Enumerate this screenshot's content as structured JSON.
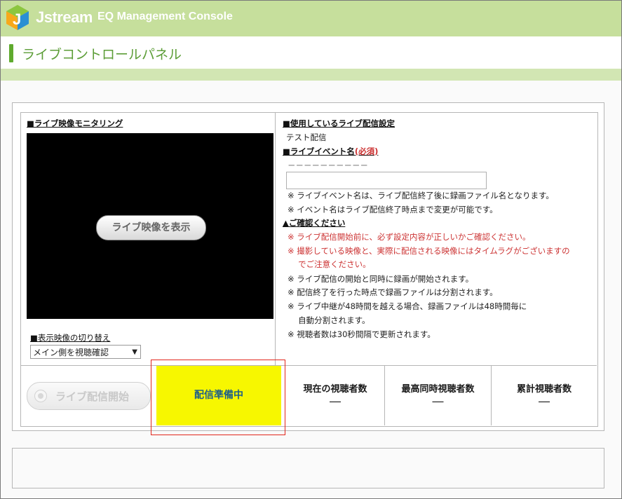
{
  "header": {
    "logo_text": "Jstream",
    "app_title": "EQ Management Console"
  },
  "page": {
    "title": "ライブコントロールパネル"
  },
  "left_panel": {
    "monitor_heading": "■ライブ映像モニタリング",
    "show_video_button": "ライブ映像を表示",
    "switch_heading": "■表示映像の切り替え",
    "switch_select_value": "メイン側を視聴確認"
  },
  "right_panel": {
    "settings_heading": "■使用しているライブ配信設定",
    "settings_value": "テスト配信",
    "event_name_heading": "■ライブイベント名",
    "event_name_required": "(必須)",
    "event_name_value": "－－－－－－－－－－",
    "event_name_input_value": "",
    "notes1": [
      "※ ライブイベント名は、ライブ配信終了後に録画ファイル名となります。",
      "※ イベント名はライブ配信終了時点まで変更が可能です。"
    ],
    "confirm_heading": "▲ご確認ください",
    "warnings": [
      "※ ライブ配信開始前に、必ず設定内容が正しいかご確認ください。",
      "※ 撮影している映像と、実際に配信される映像にはタイムラグがございますの",
      "　 でご注意ください。"
    ],
    "notes2": [
      "※ ライブ配信の開始と同時に録画が開始されます。",
      "※ 配信終了を行った時点で録画ファイルは分割されます。",
      "※ ライブ中継が48時間を越える場合、録画ファイルは48時間毎に",
      "　 自動分割されます。",
      "※ 視聴者数は30秒間隔で更新されます。"
    ]
  },
  "controls": {
    "start_button": "ライブ配信開始",
    "status": "配信準備中"
  },
  "stats": [
    {
      "label": "現在の視聴者数",
      "value": "―"
    },
    {
      "label": "最高同時視聴者数",
      "value": "―"
    },
    {
      "label": "累計視聴者数",
      "value": "―"
    }
  ],
  "colors": {
    "header_green": "#c6df9c",
    "title_green": "#5c9d37",
    "status_yellow": "#f7f700",
    "highlight_red": "#e1261c",
    "warning_red": "#cc3333"
  }
}
